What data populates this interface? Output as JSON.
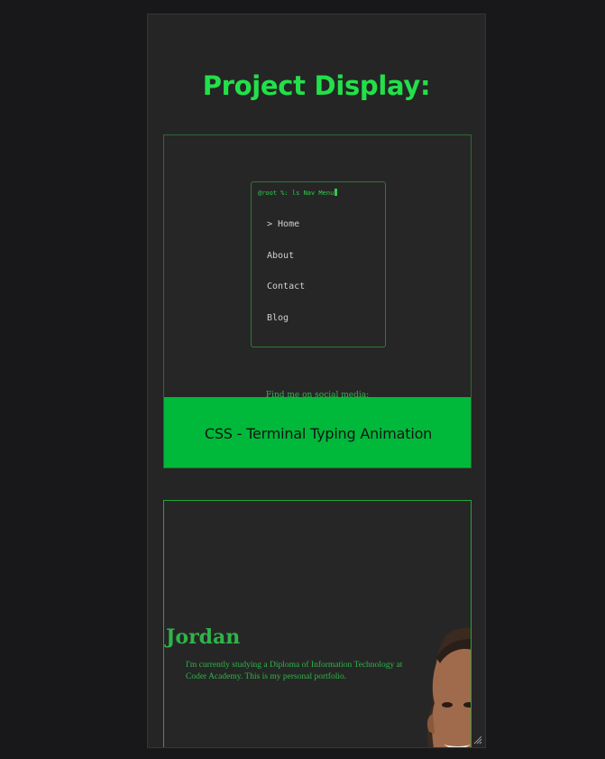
{
  "section": {
    "title": "Project Display:"
  },
  "project1": {
    "terminal": {
      "prompt": "@root %: ls Nav Menu",
      "menu": [
        {
          "label": "> Home"
        },
        {
          "label": "About"
        },
        {
          "label": "Contact"
        },
        {
          "label": "Blog"
        }
      ]
    },
    "social_text": "Find me on social media:",
    "caption": "CSS - Terminal Typing Animation"
  },
  "project2": {
    "name": "Jordan",
    "bio": "I'm currently studying a Diploma of Information Technology at Coder Academy. This is my personal portfolio."
  },
  "colors": {
    "accent": "#22e04a",
    "banner": "#00b93a",
    "background": "#18181a",
    "panel": "#252525"
  }
}
